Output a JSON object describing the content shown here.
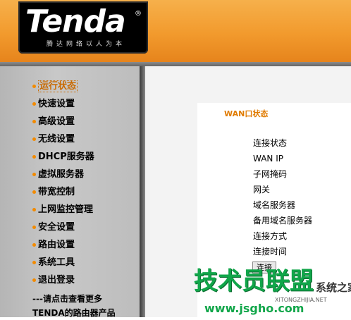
{
  "header": {
    "logo_text": "Tenda",
    "logo_reg": "®",
    "slogan": "腾达网络以人为本"
  },
  "nav": {
    "items": [
      {
        "label": "运行状态",
        "active": true
      },
      {
        "label": "快速设置"
      },
      {
        "label": "高级设置"
      },
      {
        "label": "无线设置"
      },
      {
        "label": "DHCP服务器"
      },
      {
        "label": "虚拟服务器"
      },
      {
        "label": "带宽控制"
      },
      {
        "label": "上网监控管理"
      },
      {
        "label": "安全设置"
      },
      {
        "label": "路由设置"
      },
      {
        "label": "系统工具"
      },
      {
        "label": "退出登录"
      }
    ],
    "footer_line1": "---请点击查看更多",
    "footer_line2": "TENDA的路由器产品"
  },
  "main": {
    "panel_title": "WAN口状态",
    "status_labels": [
      "连接状态",
      "WAN IP",
      "子网掩码",
      "网关",
      "域名服务器",
      "备用域名服务器",
      "连接方式",
      "连接时间"
    ],
    "connect_button": "连接"
  },
  "watermark": {
    "big": "技术员联盟",
    "small": "系统之家",
    "sub": "XITONGZHIJIA.NET",
    "url": "www.jsgho.com"
  },
  "colors": {
    "header_orange": "#f29a2d",
    "nav_bullet": "#f28a00",
    "panel_title": "#e07b00",
    "watermark_green": "#11a64a"
  }
}
